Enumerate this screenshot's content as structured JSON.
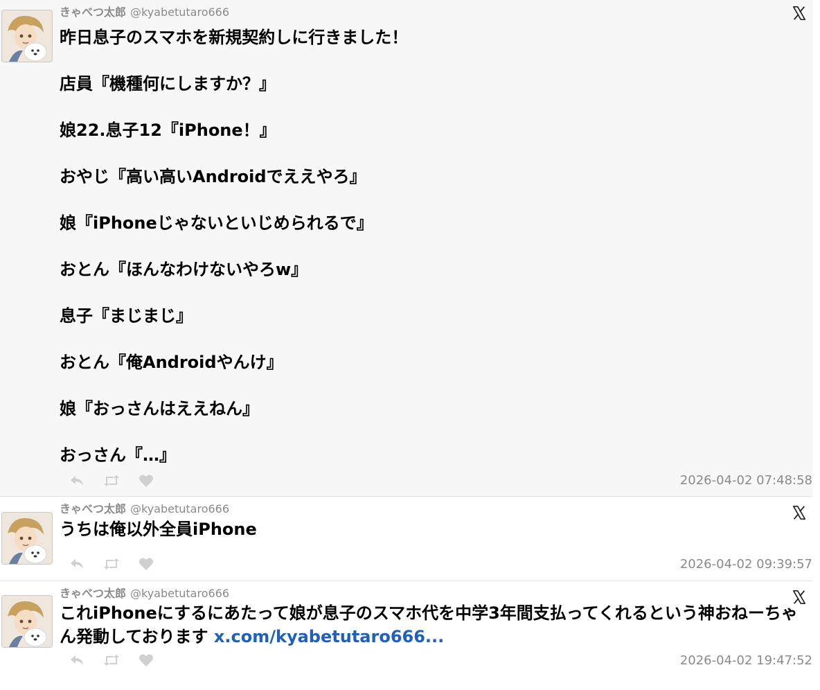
{
  "tweets": [
    {
      "name": "きゃべつ太郎",
      "handle": "@kyabetutaro666",
      "text": "昨日息子のスマホを新規契約しに行きました！\n\n店員『機種何にしますか？』\n\n娘22.息子12『iPhone！』\n\nおやじ『高い高いAndroidでええやろ』\n\n娘『iPhoneじゃないといじめられるで』\n\nおとん『ほんなわけないやろw』\n\n息子『まじまじ』\n\nおとん『俺Androidやんけ』\n\n娘『おっさんはええねん』\n\nおっさん『…』",
      "timestamp": "2026-04-02 07:48:58"
    },
    {
      "name": "きゃべつ太郎",
      "handle": "@kyabetutaro666",
      "text": "うちは俺以外全員iPhone",
      "timestamp": "2026-04-02 09:39:57"
    },
    {
      "name": "きゃべつ太郎",
      "handle": "@kyabetutaro666",
      "text": "これiPhoneにするにあたって娘が息子のスマホ代を中学3年間支払ってくれるという神おねーちゃん発動しております ",
      "link": "x.com/kyabetutaro666...",
      "timestamp": "2026-04-02 19:47:52"
    }
  ],
  "icons": {
    "close": "x-logo-icon",
    "reply": "reply-icon",
    "retweet": "retweet-icon",
    "like": "heart-icon"
  },
  "colors": {
    "link": "#2060b8",
    "meta_text": "#8a8a8a",
    "icon_gray": "#d0d0d0",
    "tweet1_background": "#f7f7f7"
  }
}
